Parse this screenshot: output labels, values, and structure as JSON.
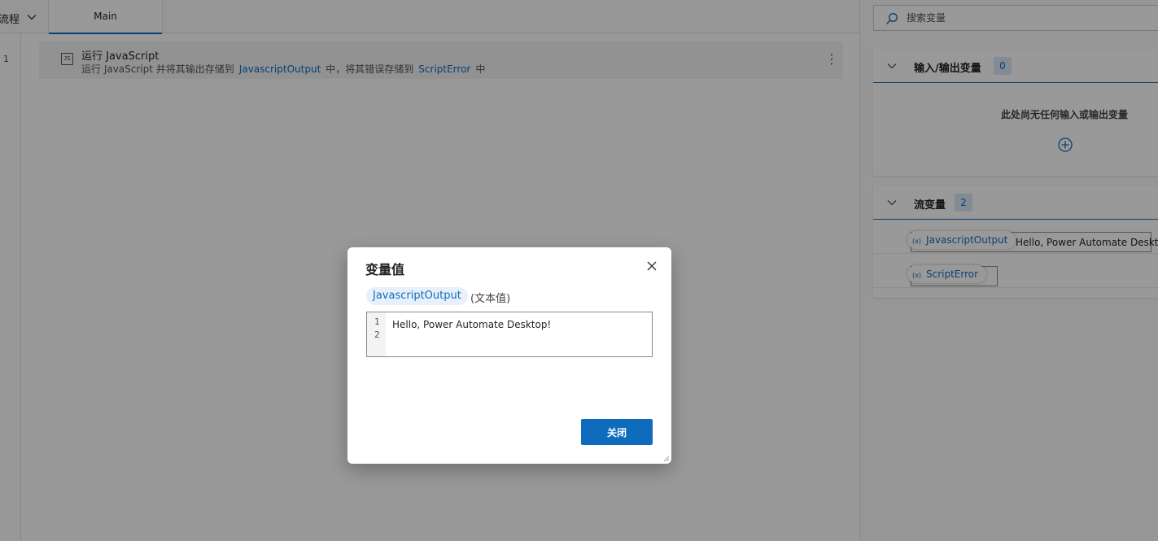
{
  "tabs": {
    "prev_label": "流程",
    "main_label": "Main"
  },
  "flow": {
    "line_number": "1",
    "action": {
      "icon_label": "JS",
      "title": "运行 JavaScript",
      "desc_prefix": "运行 JavaScript 并将其输出存储到",
      "output_var": "JavascriptOutput",
      "desc_middle": "中，将其错误存储到",
      "error_var": "ScriptError",
      "desc_suffix": "中",
      "more_icon": "⋮"
    }
  },
  "variables_panel": {
    "search_placeholder": "搜索变量",
    "io_section": {
      "title": "输入/输出变量",
      "count": "0",
      "empty_message": "此处尚无任何输入或输出变量"
    },
    "flow_section": {
      "title": "流变量",
      "count": "2",
      "items": [
        {
          "icon": "(x)",
          "name": "JavascriptOutput",
          "value": "Hello, Power Automate Deskt..."
        },
        {
          "icon": "(x)",
          "name": "ScriptError",
          "value": ""
        }
      ]
    }
  },
  "dialog": {
    "title": "变量值",
    "variable_name": "JavascriptOutput",
    "variable_type": "(文本值)",
    "editor_lines": [
      "1",
      "2"
    ],
    "editor_text": "Hello, Power Automate Desktop!",
    "close_button_label": "关闭"
  },
  "colors": {
    "accent": "#0f6cbd",
    "overlay": "rgba(0,0,0,0.40)",
    "pill_bg": "#e8f1fb"
  }
}
